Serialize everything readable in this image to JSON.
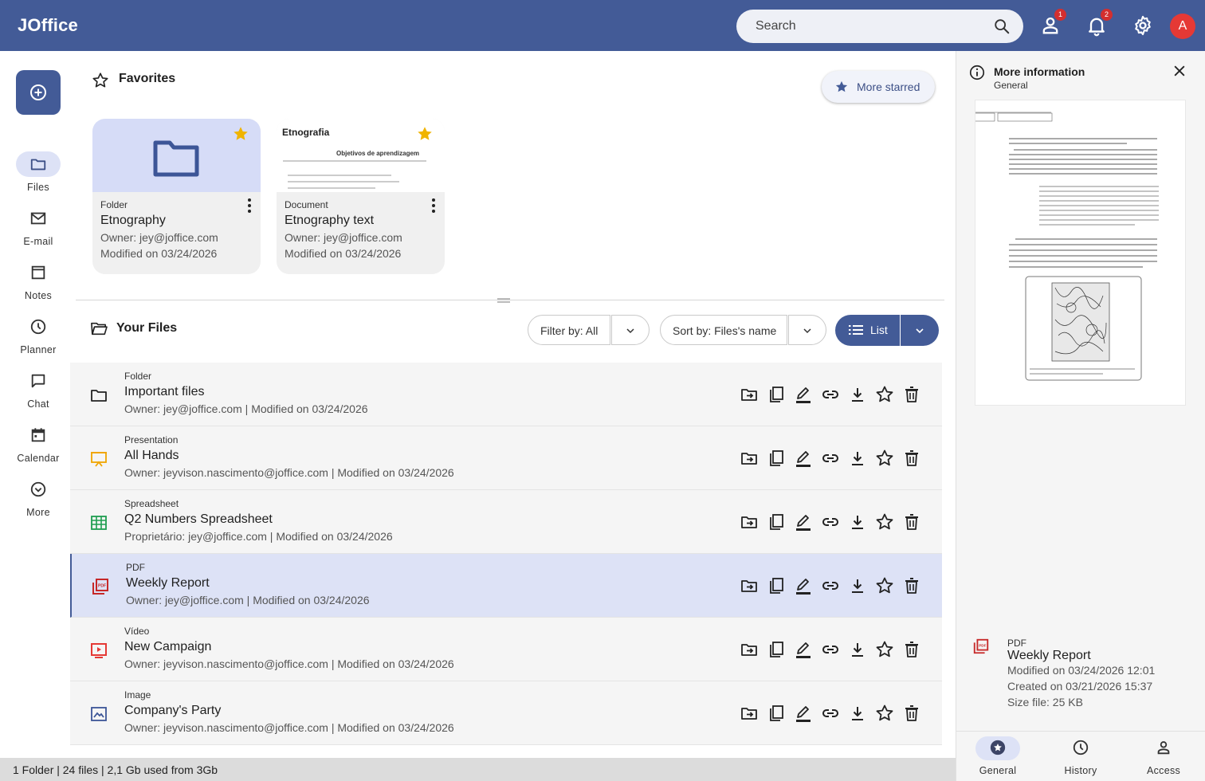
{
  "app": {
    "title": "JOffice"
  },
  "header": {
    "search_placeholder": "Search",
    "contacts_badge": "1",
    "notifications_badge": "2",
    "avatar_initial": "A"
  },
  "nav": {
    "items": [
      {
        "label": "Files",
        "icon": "folder-icon",
        "active": true
      },
      {
        "label": "E-mail",
        "icon": "mail-icon"
      },
      {
        "label": "Notes",
        "icon": "notes-icon"
      },
      {
        "label": "Planner",
        "icon": "clock-icon"
      },
      {
        "label": "Chat",
        "icon": "chat-icon"
      },
      {
        "label": "Calendar",
        "icon": "calendar-icon"
      },
      {
        "label": "More",
        "icon": "chevron-down-circle-icon"
      }
    ]
  },
  "favorites": {
    "title": "Favorites",
    "more_label": "More starred",
    "cards": [
      {
        "type": "Folder",
        "name": "Etnography",
        "owner": "Owner: jey@joffice.com",
        "modified": "Modified on 03/24/2026"
      },
      {
        "type": "Document",
        "name": "Etnography text",
        "owner": "Owner: jey@joffice.com",
        "modified": "Modified on 03/24/2026",
        "thumb_title": "Etnografia",
        "thumb_heading": "Objetivos de aprendizagem"
      }
    ]
  },
  "files": {
    "title": "Your Files",
    "filter_label": "Filter by: All",
    "sort_label": "Sort by: Files's name",
    "view_label": "List",
    "rows": [
      {
        "type": "Folder",
        "name": "Important files",
        "meta": "Owner: jey@joffice.com | Modified on 03/24/2026",
        "icon": "folder-icon",
        "color": "#222222"
      },
      {
        "type": "Presentation",
        "name": "All Hands",
        "meta": "Owner: jeyvison.nascimento@joffice.com | Modified on 03/24/2026",
        "icon": "presentation-icon",
        "color": "#f0a500"
      },
      {
        "type": "Spreadsheet",
        "name": "Q2 Numbers Spreadsheet",
        "meta": "Proprietário: jey@joffice.com | Modified on 03/24/2026",
        "icon": "spreadsheet-icon",
        "color": "#1e9e50"
      },
      {
        "type": "PDF",
        "name": "Weekly Report",
        "meta": "Owner: jey@joffice.com | Modified on 03/24/2026",
        "icon": "pdf-icon",
        "color": "#c62828",
        "selected": true
      },
      {
        "type": "Vídeo",
        "name": "New Campaign",
        "meta": "Owner: jeyvison.nascimento@joffice.com | Modified on 03/24/2026",
        "icon": "video-icon",
        "color": "#e53935"
      },
      {
        "type": "Image",
        "name": "Company's Party",
        "meta": "Owner: jeyvison.nascimento@joffice.com | Modified on 03/24/2026",
        "icon": "image-icon",
        "color": "#3c5597"
      }
    ]
  },
  "status": {
    "text": "1 Folder | 24 files | 2,1 Gb used from 3Gb"
  },
  "info_panel": {
    "title": "More information",
    "subtitle": "General",
    "file_type": "PDF",
    "file_name": "Weekly Report",
    "modified": "Modified on 03/24/2026 12:01",
    "created": "Created on 03/21/2026 15:37",
    "size": "Size file: 25 KB",
    "tabs": [
      {
        "label": "General",
        "icon": "star-circle-icon",
        "active": true
      },
      {
        "label": "History",
        "icon": "history-icon"
      },
      {
        "label": "Access",
        "icon": "person-icon"
      }
    ]
  },
  "colors": {
    "primary": "#435b97",
    "selected_row": "#dde2f6",
    "star": "#f0b400"
  }
}
